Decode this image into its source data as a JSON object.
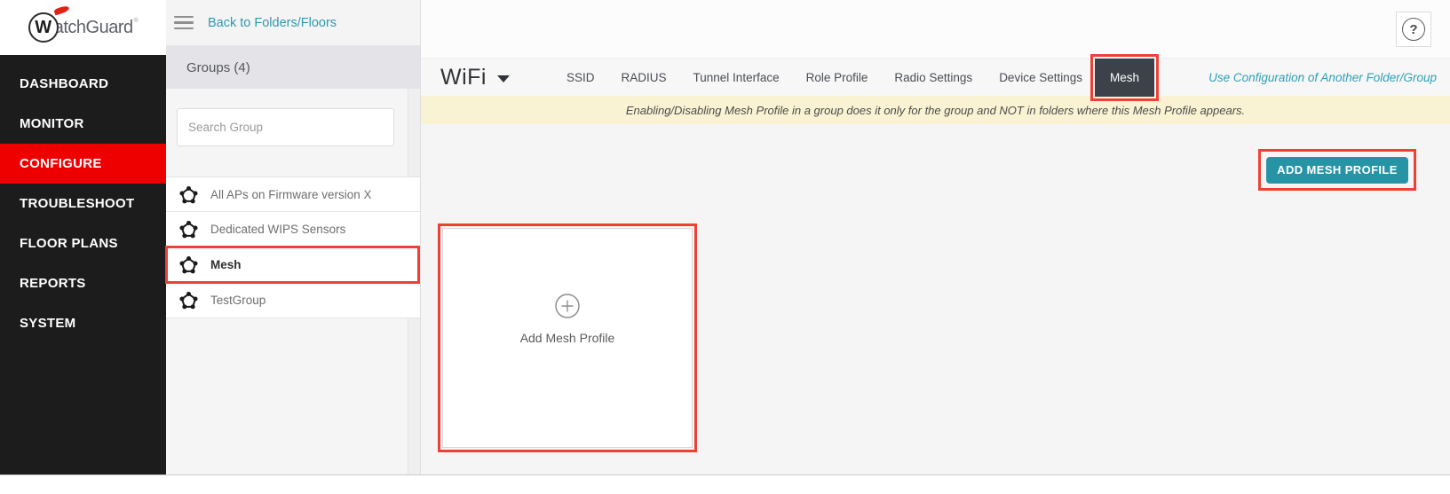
{
  "brand": {
    "mark": "W",
    "name_rest": "atchGuard",
    "registered": "®"
  },
  "sidebar": {
    "items": [
      {
        "label": "DASHBOARD",
        "active": false
      },
      {
        "label": "MONITOR",
        "active": false
      },
      {
        "label": "CONFIGURE",
        "active": true
      },
      {
        "label": "TROUBLESHOOT",
        "active": false
      },
      {
        "label": "FLOOR PLANS",
        "active": false
      },
      {
        "label": "REPORTS",
        "active": false
      },
      {
        "label": "SYSTEM",
        "active": false
      }
    ]
  },
  "group_panel": {
    "back_label": "Back to Folders/Floors",
    "title": "Groups (4)",
    "search_placeholder": "Search Group",
    "groups": [
      {
        "label": "All APs on Firmware version X",
        "selected": false
      },
      {
        "label": "Dedicated WIPS Sensors",
        "selected": false
      },
      {
        "label": "Mesh",
        "selected": true
      },
      {
        "label": "TestGroup",
        "selected": false
      }
    ]
  },
  "main": {
    "scope_label": "WiFi",
    "tabs": [
      "SSID",
      "RADIUS",
      "Tunnel Interface",
      "Role Profile",
      "Radio Settings",
      "Device Settings",
      "Mesh"
    ],
    "active_tab": "Mesh",
    "alt_link": "Use Configuration of Another Folder/Group",
    "banner": "Enabling/Disabling Mesh Profile in a group does it only for the group and NOT in folders where this Mesh Profile appears.",
    "add_button_label": "ADD MESH PROFILE",
    "card_label": "Add Mesh Profile",
    "help_icon": "?"
  },
  "colors": {
    "sidebar_bg": "#1c1c1c",
    "configure_active_red": "#ee0000",
    "annotation_red": "#ee4035",
    "teal_link": "#2f9fb5",
    "button_teal": "#2794a5",
    "active_tab_bg": "#3d414a",
    "banner_bg": "#faf3d3",
    "panel_bg": "#f5f5f5"
  }
}
